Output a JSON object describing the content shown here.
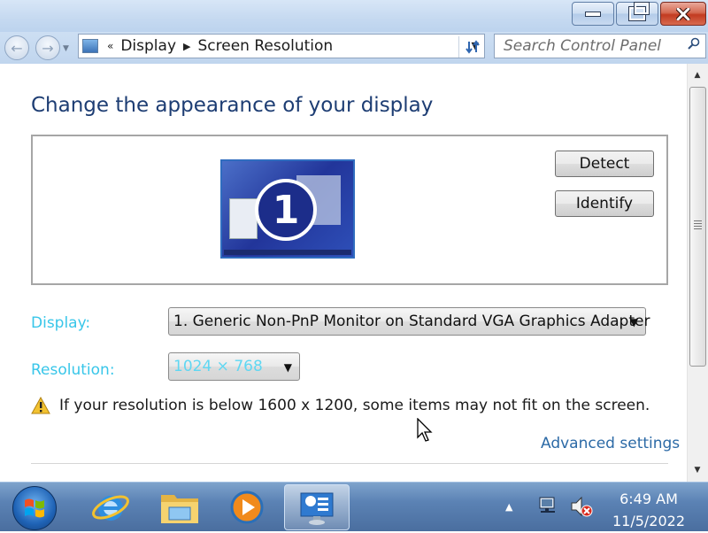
{
  "window": {
    "caption_buttons": [
      "minimize",
      "restore",
      "close"
    ]
  },
  "address_bar": {
    "breadcrumb_overflow": "«",
    "breadcrumb": [
      "Display",
      "Screen Resolution"
    ]
  },
  "search": {
    "placeholder": "Search Control Panel"
  },
  "main": {
    "title": "Change the appearance of your display",
    "monitor_number": "1",
    "detect_label": "Detect",
    "identify_label": "Identify",
    "display_label": "Display:",
    "display_value": "1. Generic Non-PnP Monitor on Standard VGA Graphics Adapter",
    "resolution_label": "Resolution:",
    "resolution_value": "1024 × 768",
    "warning_text": "If your resolution is below 1600 x 1200, some items may not fit on the screen.",
    "advanced_link": "Advanced settings"
  },
  "taskbar": {
    "items": [
      "start-orb",
      "internet-explorer",
      "windows-explorer",
      "windows-media-player",
      "control-panel-display"
    ],
    "active_item": "control-panel-display",
    "time": "6:49 AM",
    "date": "11/5/2022"
  },
  "colors": {
    "title_blue": "#1d3d73",
    "label_cyan": "#38c6e9",
    "link_blue": "#2c6aa6",
    "taskbar": "#5b82b4"
  }
}
